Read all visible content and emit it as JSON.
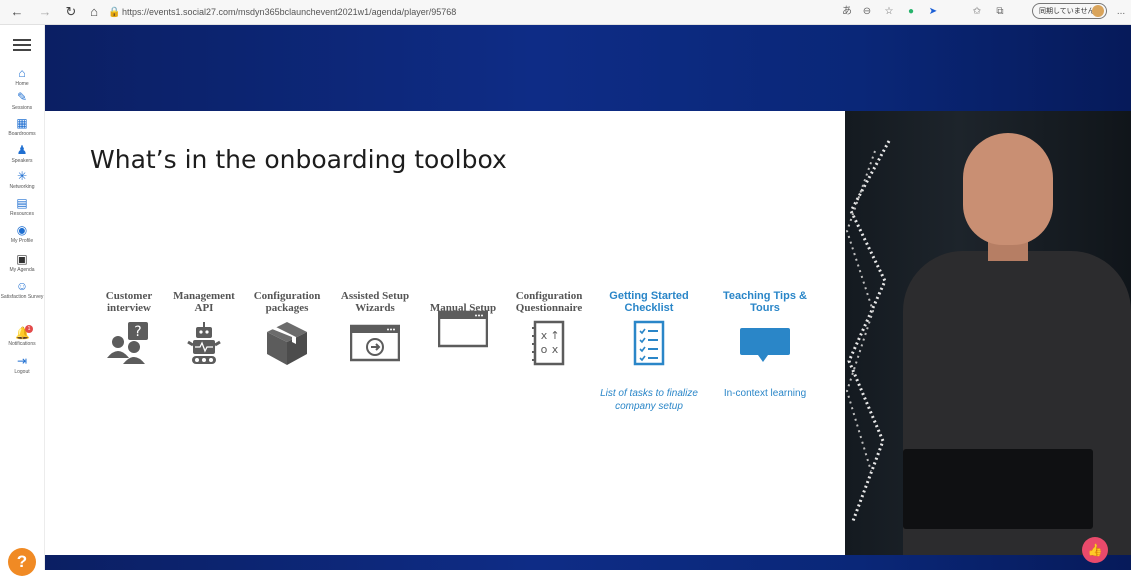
{
  "browser": {
    "url": "https://events1.social27.com/msdyn365bclaunchevent2021w1/agenda/player/95768",
    "profile_label": "同期していません",
    "more_label": "..."
  },
  "sidebar": {
    "items": [
      {
        "label": "Home",
        "icon": "home-icon"
      },
      {
        "label": "Sessions",
        "icon": "pencil-icon"
      },
      {
        "label": "Boardrooms",
        "icon": "boardroom-icon"
      },
      {
        "label": "Speakers",
        "icon": "speaker-icon"
      },
      {
        "label": "Networking",
        "icon": "network-icon"
      },
      {
        "label": "Resources",
        "icon": "resources-icon"
      },
      {
        "label": "My Profile",
        "icon": "profile-icon"
      },
      {
        "label": "My Agenda",
        "icon": "calendar-icon"
      },
      {
        "label": "Satisfaction Survey",
        "icon": "survey-icon"
      },
      {
        "label": "Notifications",
        "icon": "bell-icon",
        "badge": "1"
      },
      {
        "label": "Logout",
        "icon": "logout-icon"
      }
    ],
    "help_label": "?"
  },
  "slide": {
    "title": "What’s in the onboarding toolbox",
    "tools": [
      {
        "label": "Customer interview",
        "icon": "people-question-icon"
      },
      {
        "label": "Management API",
        "icon": "robot-icon"
      },
      {
        "label": "Configuration packages",
        "icon": "package-icon"
      },
      {
        "label": "Assisted Setup Wizards",
        "icon": "wizard-window-icon"
      },
      {
        "label": "Manual Setup",
        "icon": "window-icon"
      },
      {
        "label": "Configuration Questionnaire",
        "icon": "questionnaire-icon"
      },
      {
        "label": "Getting Started Checklist",
        "icon": "checklist-icon"
      },
      {
        "label": "Teaching Tips & Tours",
        "icon": "speech-bubble-icon"
      }
    ],
    "desc_checklist": "List of tasks to finalize company setup",
    "desc_teaching": "In-context learning"
  },
  "colors": {
    "accent": "#2a86c8",
    "gray": "#5c5c5c",
    "banner": "#0e2c86"
  }
}
